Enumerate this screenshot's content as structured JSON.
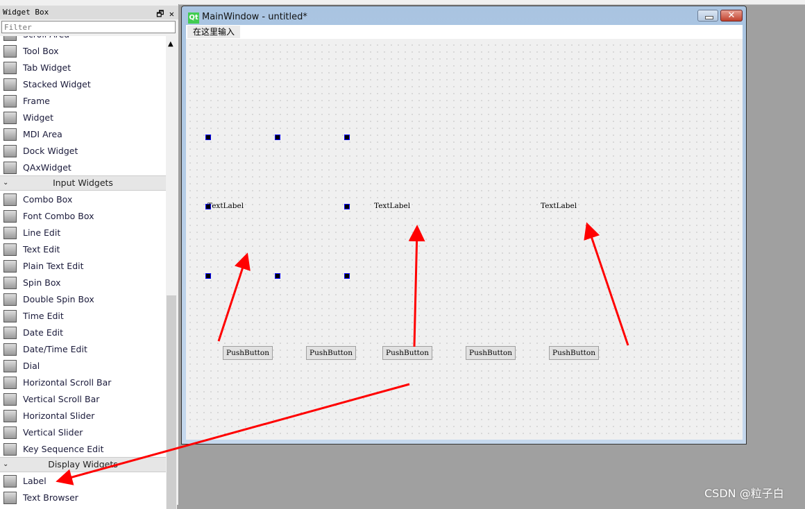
{
  "widget_box": {
    "title": "Widget Box",
    "filter_placeholder": "Filter",
    "partial_item": "Scroll Area",
    "containers": [
      "Tool Box",
      "Tab Widget",
      "Stacked Widget",
      "Frame",
      "Widget",
      "MDI Area",
      "Dock Widget",
      "QAxWidget"
    ],
    "input_category": "Input Widgets",
    "inputs": [
      "Combo Box",
      "Font Combo Box",
      "Line Edit",
      "Text Edit",
      "Plain Text Edit",
      "Spin Box",
      "Double Spin Box",
      "Time Edit",
      "Date Edit",
      "Date/Time Edit",
      "Dial",
      "Horizontal Scroll Bar",
      "Vertical Scroll Bar",
      "Horizontal Slider",
      "Vertical Slider",
      "Key Sequence Edit"
    ],
    "display_category": "Display Widgets",
    "display": [
      "Label",
      "Text Browser"
    ]
  },
  "window": {
    "title": "MainWindow - untitled*",
    "menu_placeholder": "在这里输入",
    "icon": "Qt"
  },
  "form": {
    "labels": [
      "TextLabel",
      "TextLabel",
      "TextLabel"
    ],
    "buttons": [
      "PushButton",
      "PushButton",
      "PushButton",
      "PushButton",
      "PushButton"
    ]
  },
  "annotation_color": "#ff0000",
  "watermark": "CSDN @粒子白"
}
